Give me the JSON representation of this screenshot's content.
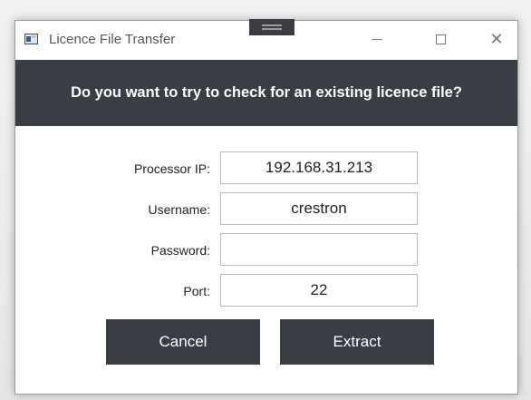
{
  "window": {
    "title": "Licence File Transfer",
    "controls": {
      "minimize": "—",
      "maximize": "☐",
      "close": "✕"
    }
  },
  "header": {
    "question": "Do you want to try to check for an existing licence file?"
  },
  "form": {
    "processor_ip": {
      "label": "Processor IP:",
      "value": "192.168.31.213"
    },
    "username": {
      "label": "Username:",
      "value": "crestron"
    },
    "password": {
      "label": "Password:",
      "value": ""
    },
    "port": {
      "label": "Port:",
      "value": "22"
    }
  },
  "buttons": {
    "cancel": "Cancel",
    "extract": "Extract"
  },
  "colors": {
    "header_bg": "#3a3d44",
    "button_bg": "#3a3d44",
    "text_light": "#ffffff"
  }
}
